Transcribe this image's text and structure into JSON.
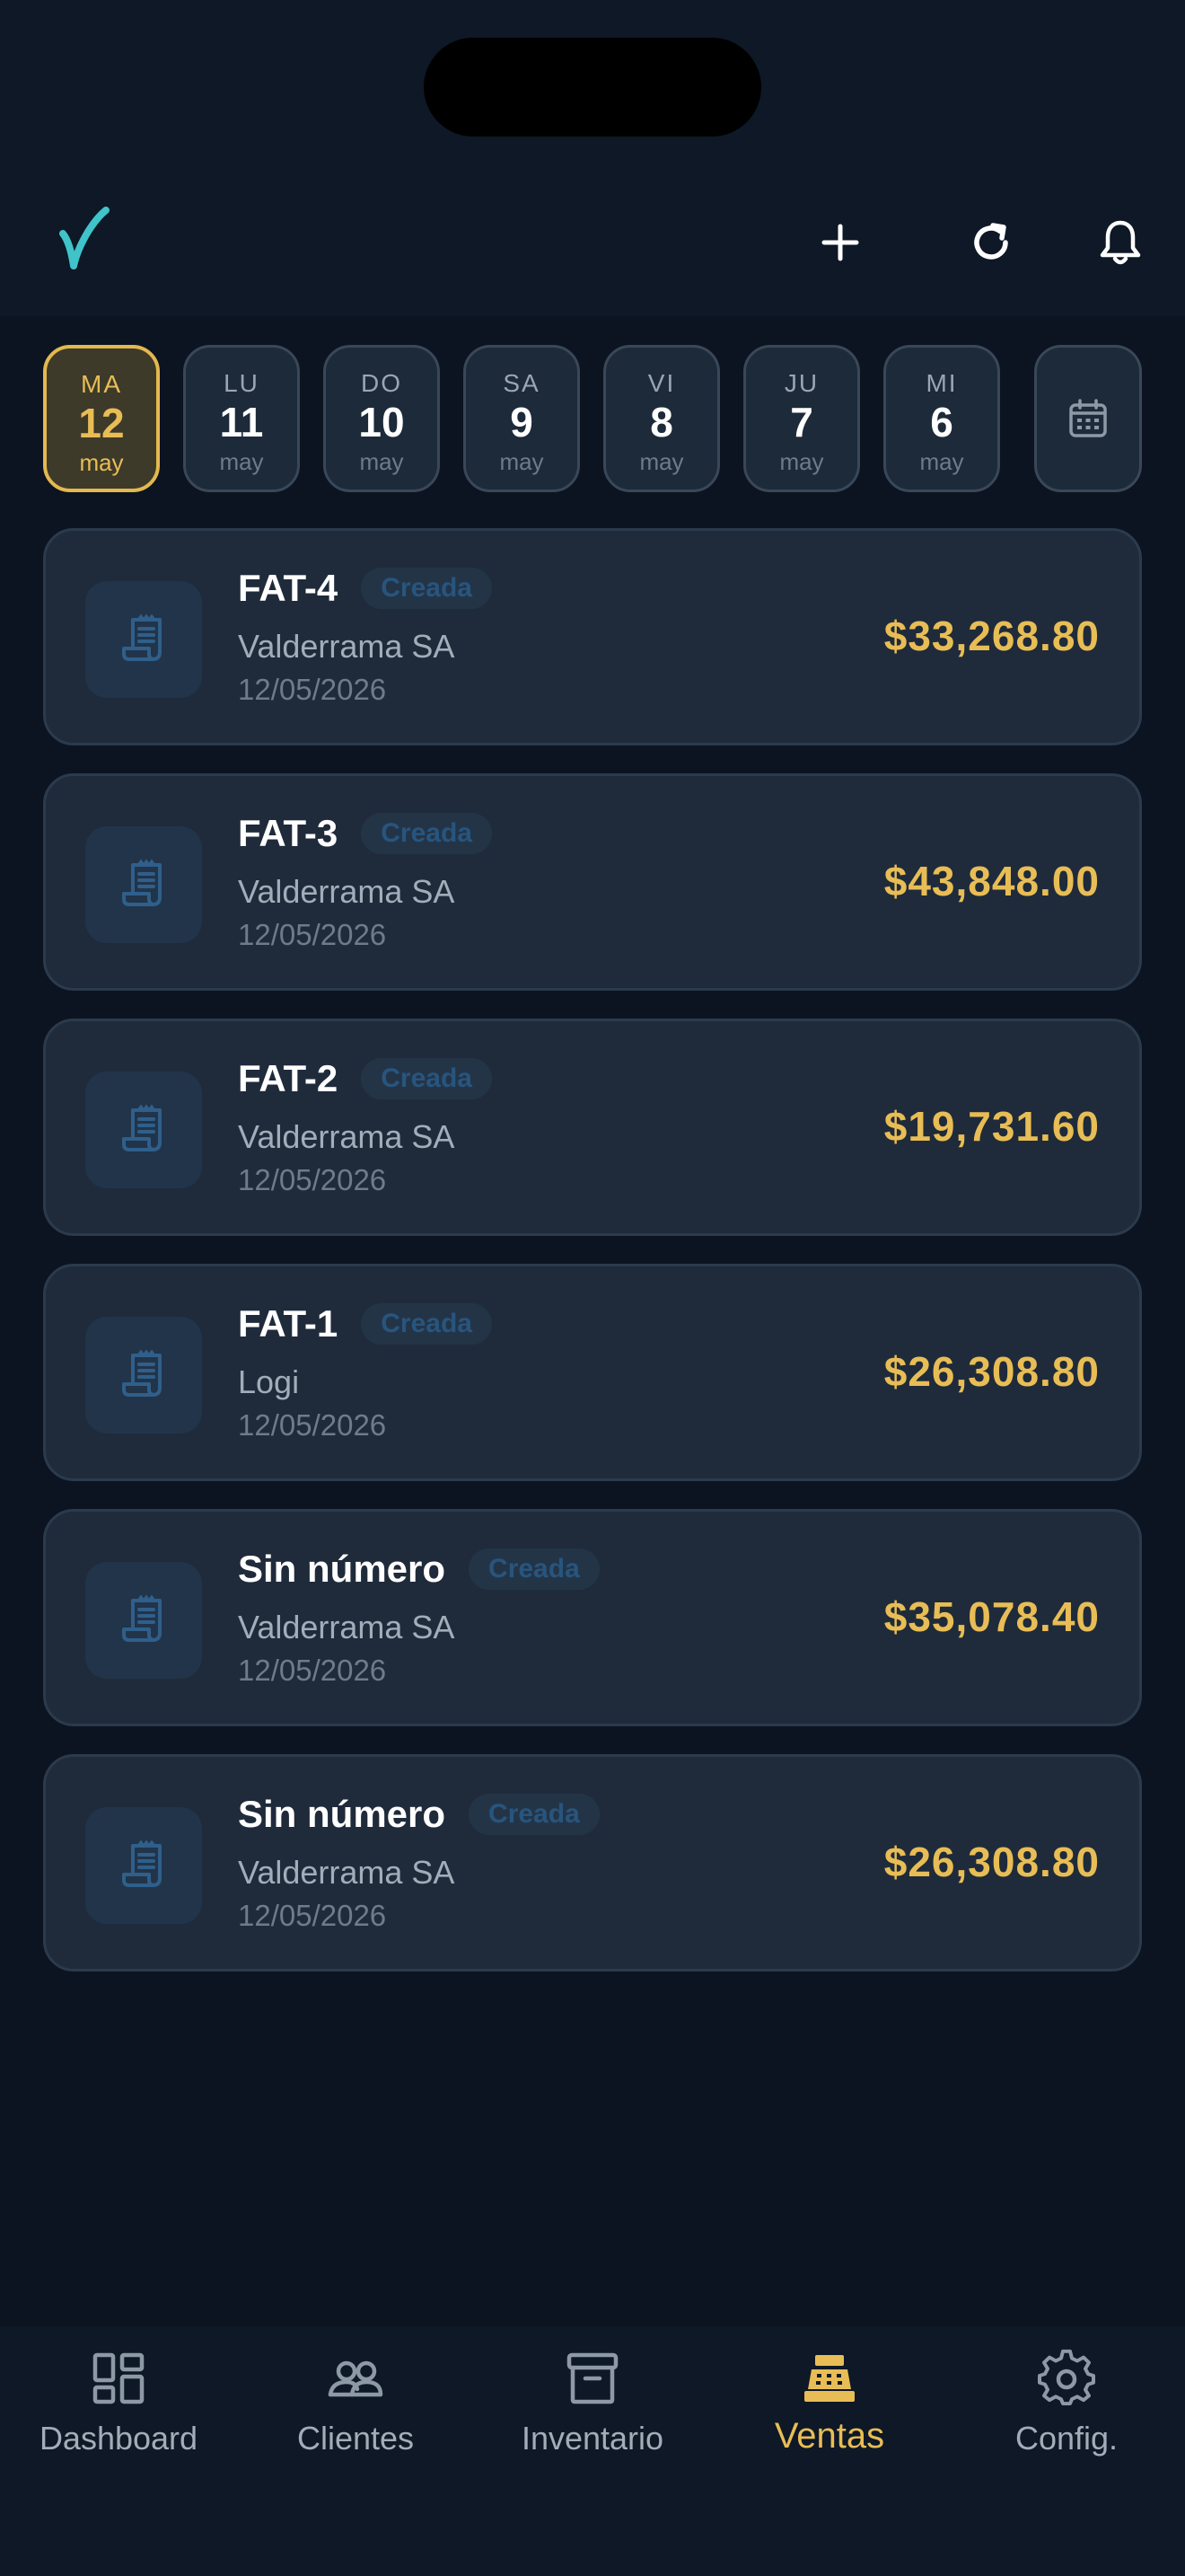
{
  "header": {
    "logo_letter": "V",
    "actions": [
      "plus-icon",
      "refresh-icon",
      "bell-icon"
    ]
  },
  "days": [
    {
      "dow": "MA",
      "num": "12",
      "mon": "may",
      "active": true
    },
    {
      "dow": "LU",
      "num": "11",
      "mon": "may",
      "active": false
    },
    {
      "dow": "DO",
      "num": "10",
      "mon": "may",
      "active": false
    },
    {
      "dow": "SA",
      "num": "9",
      "mon": "may",
      "active": false
    },
    {
      "dow": "VI",
      "num": "8",
      "mon": "may",
      "active": false
    },
    {
      "dow": "JU",
      "num": "7",
      "mon": "may",
      "active": false
    },
    {
      "dow": "MI",
      "num": "6",
      "mon": "may",
      "active": false
    }
  ],
  "invoices": [
    {
      "title": "FAT-4",
      "status": "Creada",
      "client": "Valderrama SA",
      "date": "12/05/2026",
      "amount": "$33,268.80"
    },
    {
      "title": "FAT-3",
      "status": "Creada",
      "client": "Valderrama SA",
      "date": "12/05/2026",
      "amount": "$43,848.00"
    },
    {
      "title": "FAT-2",
      "status": "Creada",
      "client": "Valderrama SA",
      "date": "12/05/2026",
      "amount": "$19,731.60"
    },
    {
      "title": "FAT-1",
      "status": "Creada",
      "client": "Logi",
      "date": "12/05/2026",
      "amount": "$26,308.80"
    },
    {
      "title": "Sin número",
      "status": "Creada",
      "client": "Valderrama SA",
      "date": "12/05/2026",
      "amount": "$35,078.40"
    },
    {
      "title": "Sin número",
      "status": "Creada",
      "client": "Valderrama SA",
      "date": "12/05/2026",
      "amount": "$26,308.80"
    }
  ],
  "nav": [
    {
      "label": "Dashboard",
      "icon": "dashboard-icon",
      "active": false
    },
    {
      "label": "Clientes",
      "icon": "clients-icon",
      "active": false
    },
    {
      "label": "Inventario",
      "icon": "inventory-icon",
      "active": false
    },
    {
      "label": "Ventas",
      "icon": "cash-register-icon",
      "active": true
    },
    {
      "label": "Config.",
      "icon": "gear-icon",
      "active": false
    }
  ],
  "colors": {
    "accent": "#e8bd55",
    "teal": "#3fc4c9",
    "background": "#0b1420",
    "card": "#1f2b3b"
  }
}
